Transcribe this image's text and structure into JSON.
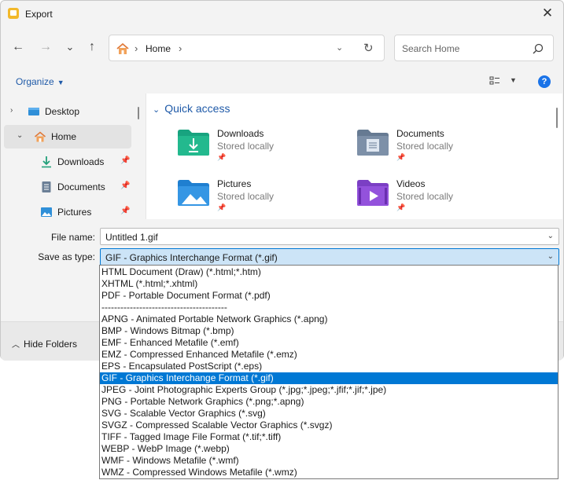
{
  "window": {
    "title": "Export"
  },
  "nav": {
    "back_icon": "←",
    "forward_icon": "→",
    "recent_icon": "⌄",
    "up_icon": "↑",
    "address": {
      "label": "Home",
      "separator": "›"
    },
    "search": {
      "placeholder": "Search Home"
    }
  },
  "commandbar": {
    "organize_label": "Organize"
  },
  "sidebar": {
    "items": [
      {
        "label": "Desktop"
      },
      {
        "label": "Home"
      },
      {
        "label": "Downloads"
      },
      {
        "label": "Documents"
      },
      {
        "label": "Pictures"
      }
    ]
  },
  "quick_access": {
    "header": "Quick access",
    "items": [
      {
        "name": "Downloads",
        "sub": "Stored locally"
      },
      {
        "name": "Documents",
        "sub": "Stored locally"
      },
      {
        "name": "Pictures",
        "sub": "Stored locally"
      },
      {
        "name": "Videos",
        "sub": "Stored locally"
      }
    ]
  },
  "form": {
    "filename_label": "File name:",
    "filename_value": "Untitled 1.gif",
    "savetype_label": "Save as type:",
    "savetype_value": "GIF - Graphics Interchange Format (*.gif)"
  },
  "footer": {
    "hide_folders_label": "Hide Folders"
  },
  "filetype_options": [
    "HTML Document (Draw) (*.html;*.htm)",
    "XHTML (*.html;*.xhtml)",
    "PDF - Portable Document Format (*.pdf)",
    "----------------------------------------",
    "APNG - Animated Portable Network Graphics (*.apng)",
    "BMP - Windows Bitmap (*.bmp)",
    "EMF - Enhanced Metafile (*.emf)",
    "EMZ - Compressed Enhanced Metafile (*.emz)",
    "EPS - Encapsulated PostScript (*.eps)",
    "GIF - Graphics Interchange Format (*.gif)",
    "JPEG - Joint Photographic Experts Group (*.jpg;*.jpeg;*.jfif;*.jif;*.jpe)",
    "PNG - Portable Network Graphics (*.png;*.apng)",
    "SVG - Scalable Vector Graphics (*.svg)",
    "SVGZ - Compressed Scalable Vector Graphics (*.svgz)",
    "TIFF - Tagged Image File Format (*.tif;*.tiff)",
    "WEBP - WebP Image (*.webp)",
    "WMF - Windows Metafile (*.wmf)",
    "WMZ - Compressed Windows Metafile (*.wmz)"
  ],
  "selected_option": "GIF - Graphics Interchange Format (*.gif)"
}
